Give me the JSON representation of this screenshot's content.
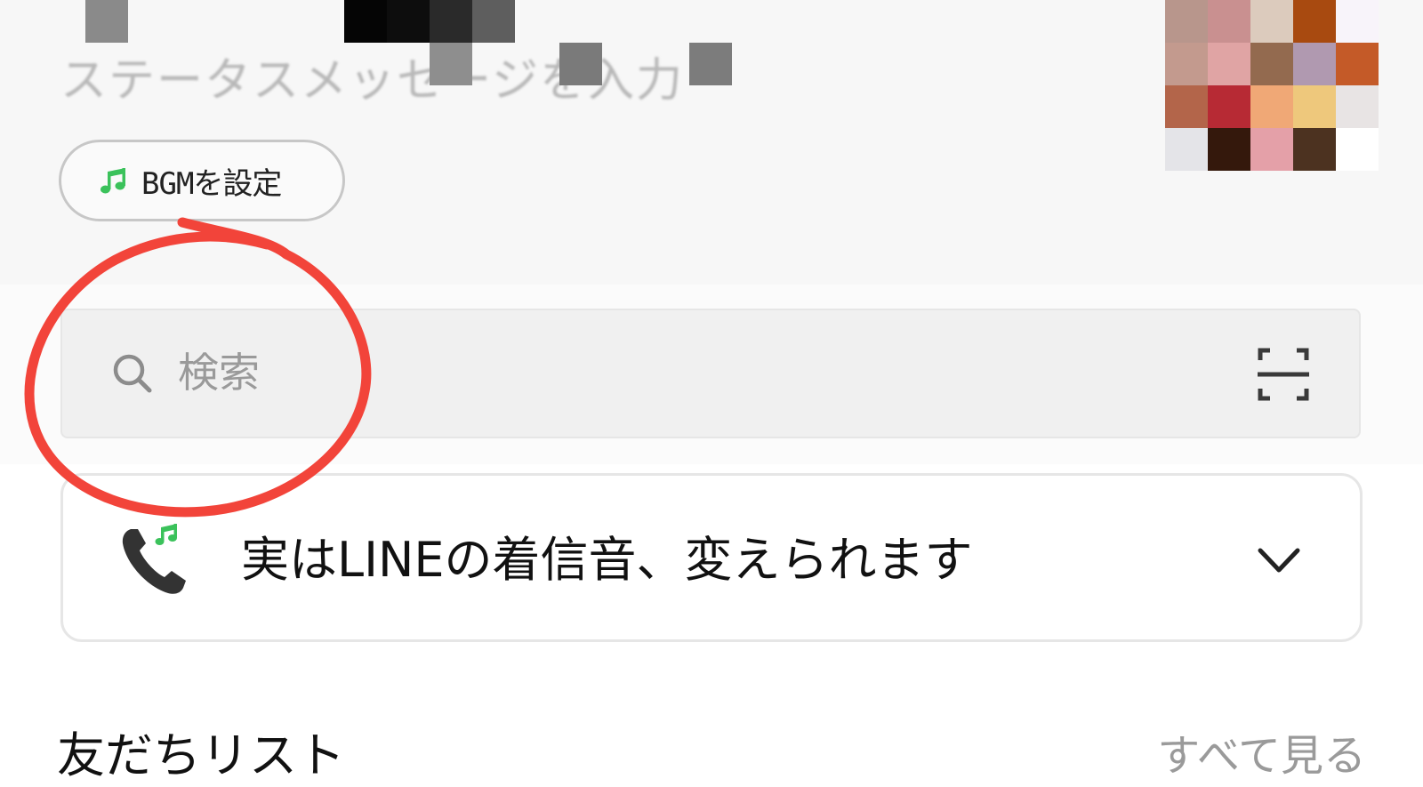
{
  "profile": {
    "status_message_placeholder": "ステータスメッセージを入力",
    "bgm_button_label": "BGMを設定"
  },
  "search": {
    "placeholder": "検索"
  },
  "notice": {
    "text": "実はLINEの着信音、変えられます"
  },
  "friends": {
    "title": "友だちリスト",
    "see_all_label": "すべて見る"
  },
  "colors": {
    "accent_green": "#3bc25b",
    "annotation_red": "#f2443a",
    "text_primary": "#111111",
    "text_muted": "#9a9a9a"
  },
  "avatar_mosaic_colors": [
    "#b8968c",
    "#c99090",
    "#dccbbd",
    "#a84a10",
    "#f8f4fa",
    "#c39a8e",
    "#e0a4a4",
    "#936a4f",
    "#b099b0",
    "#c45a28",
    "#b3654a",
    "#b72a34",
    "#f0a876",
    "#eec87c",
    "#e8e4e4",
    "#e4e4e8",
    "#34180c",
    "#e4a0a8",
    "#4c3220",
    "#ffffff"
  ]
}
